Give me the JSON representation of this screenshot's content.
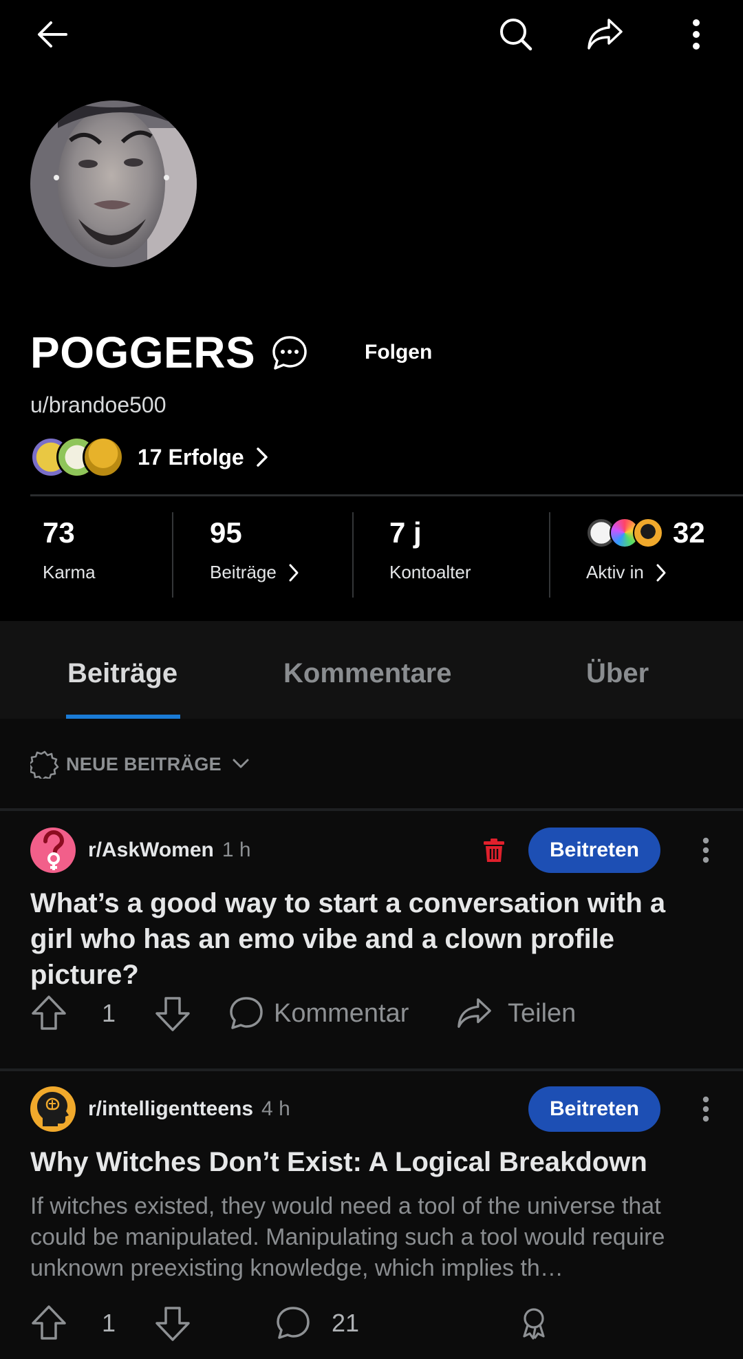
{
  "profile": {
    "display_name": "POGGERS",
    "username": "u/brandoe500",
    "follow_label": "Folgen",
    "achievements_label": "17 Erfolge"
  },
  "stats": {
    "karma": {
      "value": "73",
      "label": "Karma"
    },
    "posts": {
      "value": "95",
      "label": "Beiträge"
    },
    "age": {
      "value": "7 j",
      "label": "Kontoalter"
    },
    "active": {
      "value": "32",
      "label": "Aktiv in"
    }
  },
  "tabs": [
    {
      "label": "Beiträge",
      "active": true
    },
    {
      "label": "Kommentare",
      "active": false
    },
    {
      "label": "Über",
      "active": false
    }
  ],
  "sort": {
    "label": "NEUE BEITRÄGE"
  },
  "posts": [
    {
      "subreddit": "r/AskWomen",
      "time": "1 h",
      "join_label": "Beitreten",
      "title": "What’s a good way to start a conversation with a girl who has an emo vibe and a clown profile picture?",
      "votes": "1",
      "comment_label": "Kommentar",
      "share_label": "Teilen"
    },
    {
      "subreddit": "r/intelligentteens",
      "time": "4 h",
      "join_label": "Beitreten",
      "title": "Why Witches Don’t Exist: A Logical Breakdown",
      "body": "If witches existed, they would need a tool of the universe that could be manipulated. Manipulating such a tool would require unknown preexisting knowledge, which implies th…",
      "votes": "1",
      "comments": "21"
    }
  ],
  "colors": {
    "accent_blue": "#1d4fb4",
    "tab_indicator": "#1a7bd6",
    "delete_red": "#e0202c"
  }
}
